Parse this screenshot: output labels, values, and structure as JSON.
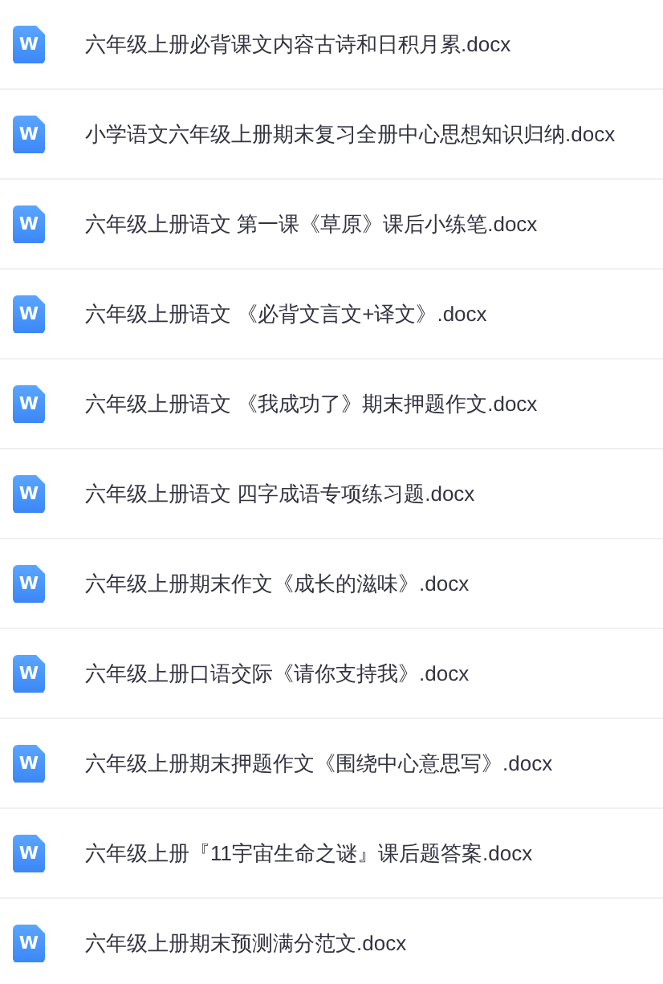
{
  "files": [
    {
      "icon_label": "W",
      "name": "六年级上册必背课文内容古诗和日积月累.docx"
    },
    {
      "icon_label": "W",
      "name": "小学语文六年级上册期末复习全册中心思想知识归纳.docx"
    },
    {
      "icon_label": "W",
      "name": "六年级上册语文 第一课《草原》课后小练笔.docx"
    },
    {
      "icon_label": "W",
      "name": "六年级上册语文 《必背文言文+译文》.docx"
    },
    {
      "icon_label": "W",
      "name": "六年级上册语文 《我成功了》期末押题作文.docx"
    },
    {
      "icon_label": "W",
      "name": "六年级上册语文 四字成语专项练习题.docx"
    },
    {
      "icon_label": "W",
      "name": "六年级上册期末作文《成长的滋味》.docx"
    },
    {
      "icon_label": "W",
      "name": "六年级上册口语交际《请你支持我》.docx"
    },
    {
      "icon_label": "W",
      "name": "六年级上册期末押题作文《围绕中心意思写》.docx"
    },
    {
      "icon_label": "W",
      "name": "六年级上册『11宇宙生命之谜』课后题答案.docx"
    },
    {
      "icon_label": "W",
      "name": "六年级上册期末预测满分范文.docx"
    }
  ]
}
